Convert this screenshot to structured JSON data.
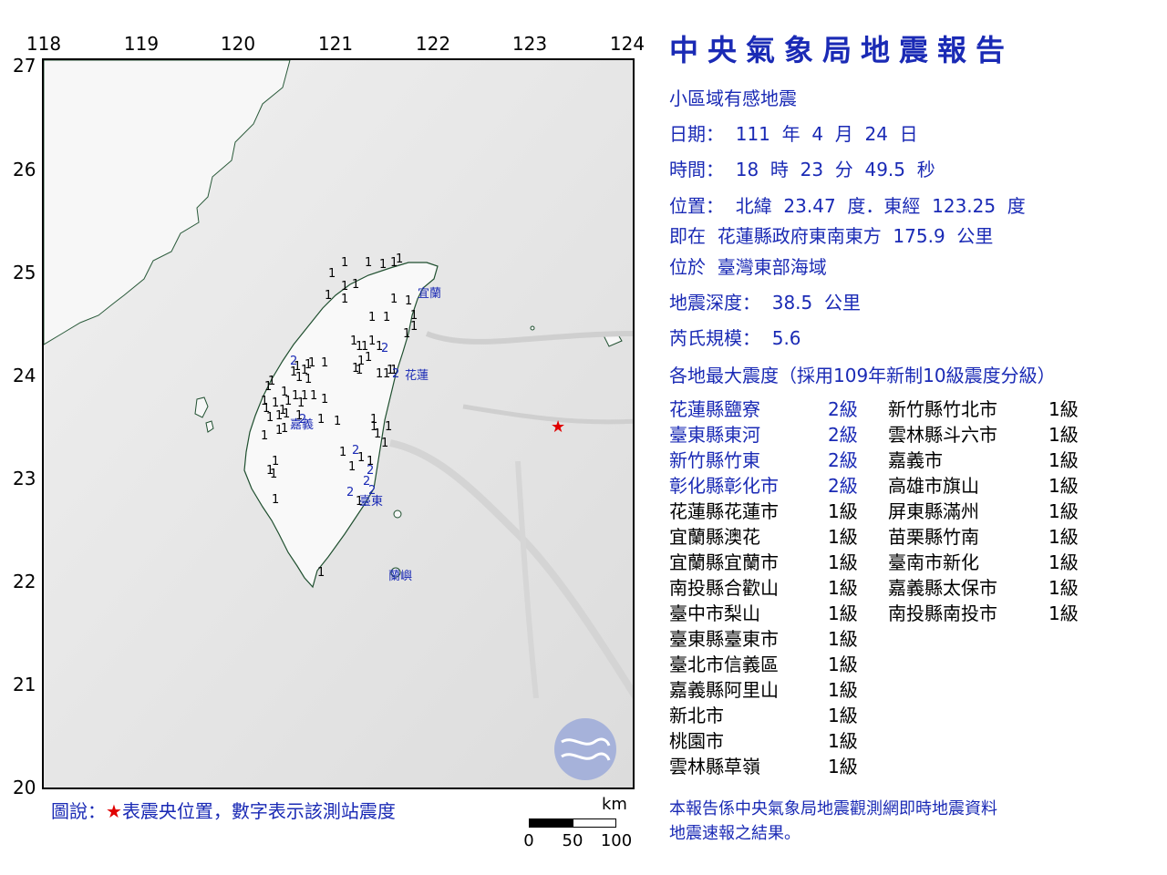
{
  "map": {
    "lon_labels": [
      "118",
      "119",
      "120",
      "121",
      "122",
      "123",
      "124"
    ],
    "lat_labels": [
      "27",
      "26",
      "25",
      "24",
      "23",
      "22",
      "21",
      "20"
    ],
    "epicenter_marker": "red-star",
    "place_labels": [
      "宜蘭",
      "花蓮",
      "嘉義",
      "臺東",
      "蘭嶼"
    ],
    "station_marks": [
      "1",
      "1",
      "1",
      "1",
      "1",
      "1",
      "1",
      "1",
      "1",
      "1",
      "1",
      "1",
      "1",
      "1",
      "1",
      "1",
      "1",
      "1",
      "1",
      "1",
      "1",
      "1",
      "1",
      "1",
      "1",
      "1",
      "1",
      "1",
      "1",
      "1",
      "1",
      "1",
      "1",
      "1",
      "1",
      "1",
      "1",
      "1",
      "1",
      "1",
      "1",
      "1",
      "1",
      "1",
      "1",
      "1",
      "1",
      "1",
      "1",
      "1",
      "1",
      "1",
      "1",
      "1",
      "1",
      "1",
      "1",
      "1",
      "1",
      "1",
      "1",
      "1",
      "1",
      "1",
      "1",
      "1",
      "1",
      "1",
      "1",
      "1",
      "1",
      "1",
      "1",
      "1",
      "1",
      "2",
      "2",
      "2",
      "2",
      "2",
      "2",
      "2",
      "2",
      "2"
    ]
  },
  "legend": {
    "prefix": "圖說：",
    "star": "★",
    "text": "表震央位置，數字表示該測站震度"
  },
  "scale": {
    "unit": "km",
    "ticks": [
      "0",
      "50",
      "100"
    ]
  },
  "report": {
    "title": "中央氣象局地震報告",
    "type": "小區域有感地震",
    "date": "日期：  111  年  4  月  24  日",
    "time": "時間：  18  時  23  分  49.5  秒",
    "location": "位置：  北緯  23.47  度．東經  123.25  度",
    "relative": "即在  花蓮縣政府東南東方  175.9  公里",
    "region": "位於  臺灣東部海域",
    "depth": "地震深度：  38.5  公里",
    "magnitude": "芮氏規模：  5.6",
    "intensity_heading": "各地最大震度（採用109年新制10級震度分級）",
    "intensity_left": [
      {
        "place": "花蓮縣鹽寮",
        "level": "2級",
        "hi": true
      },
      {
        "place": "臺東縣東河",
        "level": "2級",
        "hi": true
      },
      {
        "place": "新竹縣竹東",
        "level": "2級",
        "hi": true
      },
      {
        "place": "彰化縣彰化市",
        "level": "2級",
        "hi": true
      },
      {
        "place": "花蓮縣花蓮市",
        "level": "1級",
        "hi": false
      },
      {
        "place": "宜蘭縣澳花",
        "level": "1級",
        "hi": false
      },
      {
        "place": "宜蘭縣宜蘭市",
        "level": "1級",
        "hi": false
      },
      {
        "place": "南投縣合歡山",
        "level": "1級",
        "hi": false
      },
      {
        "place": "臺中市梨山",
        "level": "1級",
        "hi": false
      },
      {
        "place": "臺東縣臺東市",
        "level": "1級",
        "hi": false
      },
      {
        "place": "臺北市信義區",
        "level": "1級",
        "hi": false
      },
      {
        "place": "嘉義縣阿里山",
        "level": "1級",
        "hi": false
      },
      {
        "place": "新北市",
        "level": "1級",
        "hi": false
      },
      {
        "place": "桃園市",
        "level": "1級",
        "hi": false
      },
      {
        "place": "雲林縣草嶺",
        "level": "1級",
        "hi": false
      }
    ],
    "intensity_right": [
      {
        "place": "新竹縣竹北市",
        "level": "1級"
      },
      {
        "place": "雲林縣斗六市",
        "level": "1級"
      },
      {
        "place": "嘉義市",
        "level": "1級"
      },
      {
        "place": "高雄市旗山",
        "level": "1級"
      },
      {
        "place": "屏東縣滿州",
        "level": "1級"
      },
      {
        "place": "苗栗縣竹南",
        "level": "1級"
      },
      {
        "place": "臺南市新化",
        "level": "1級"
      },
      {
        "place": "嘉義縣太保市",
        "level": "1級"
      },
      {
        "place": "南投縣南投市",
        "level": "1級"
      }
    ],
    "footer_line1": "本報告係中央氣象局地震觀測網即時地震資料",
    "footer_line2": "地震速報之結果。"
  },
  "colors": {
    "accent": "#1a2ab5",
    "epicenter": "#e00000",
    "land": "#f6f6f6",
    "sea": "#e6e6e6"
  }
}
